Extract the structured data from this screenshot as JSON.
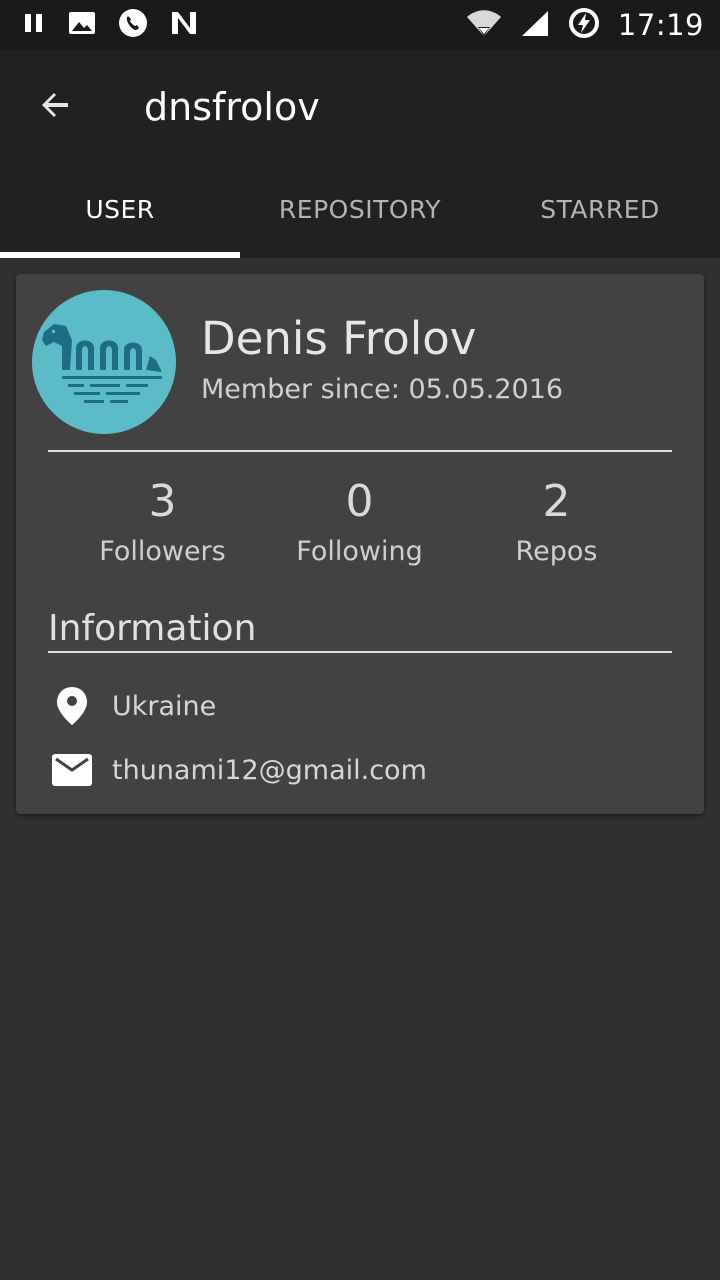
{
  "status_bar": {
    "time": "17:19",
    "left_icons": [
      "pause-icon",
      "image-icon",
      "phone-call-icon",
      "n-logo-icon"
    ],
    "right_icons": [
      "wifi-icon",
      "signal-icon",
      "battery-charging-icon"
    ]
  },
  "toolbar": {
    "back_icon": "arrow-back-icon",
    "title": "dnsfrolov"
  },
  "tabs": [
    {
      "label": "USER",
      "active": true
    },
    {
      "label": "REPOSITORY",
      "active": false
    },
    {
      "label": "STARRED",
      "active": false
    }
  ],
  "profile": {
    "name": "Denis Frolov",
    "member_since": "Member since: 05.05.2016",
    "avatar_icon": "sea-serpent-avatar-icon"
  },
  "stats": [
    {
      "value": "3",
      "label": "Followers"
    },
    {
      "value": "0",
      "label": "Following"
    },
    {
      "value": "2",
      "label": "Repos"
    }
  ],
  "information": {
    "title": "Information",
    "location": {
      "icon": "location-pin-icon",
      "text": "Ukraine"
    },
    "email": {
      "icon": "email-icon",
      "text": "thunami12@gmail.com"
    }
  },
  "colors": {
    "status_bar": "#1a1a1a",
    "toolbar": "#212121",
    "background": "#303030",
    "card": "#424242",
    "avatar_bg": "#5bbcc8",
    "avatar_art": "#1f6c85"
  }
}
